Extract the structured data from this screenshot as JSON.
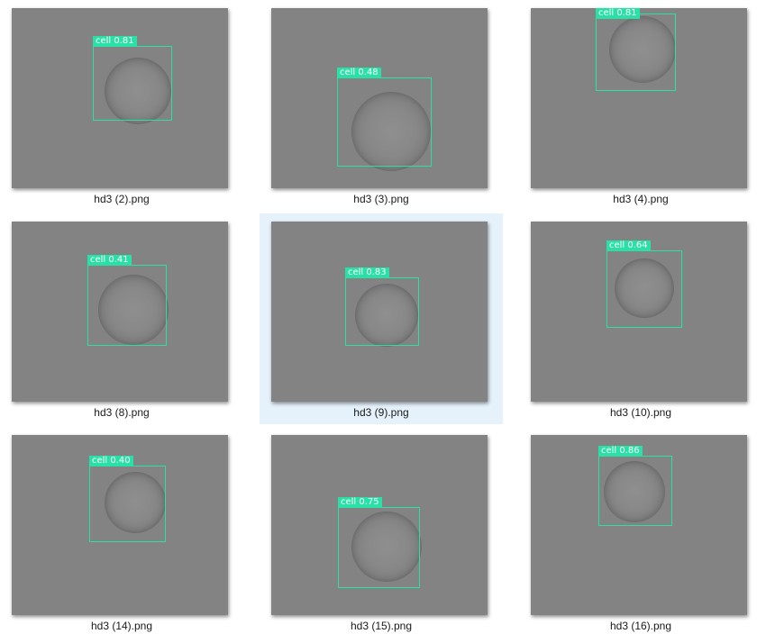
{
  "explorer": {
    "items": [
      {
        "filename": "hd3 (2).png",
        "detection": {
          "label": "cell 0.81",
          "confidence": 0.81
        },
        "selected": false
      },
      {
        "filename": "hd3 (3).png",
        "detection": {
          "label": "cell 0.48",
          "confidence": 0.48
        },
        "selected": false
      },
      {
        "filename": "hd3 (4).png",
        "detection": {
          "label": "cell 0.81",
          "confidence": 0.81
        },
        "selected": false
      },
      {
        "filename": "hd3 (8).png",
        "detection": {
          "label": "cell 0.41",
          "confidence": 0.41
        },
        "selected": false
      },
      {
        "filename": "hd3 (9).png",
        "detection": {
          "label": "cell 0.83",
          "confidence": 0.83
        },
        "selected": true
      },
      {
        "filename": "hd3 (10).png",
        "detection": {
          "label": "cell 0.64",
          "confidence": 0.64
        },
        "selected": false
      },
      {
        "filename": "hd3 (14).png",
        "detection": {
          "label": "cell 0.40",
          "confidence": 0.4
        },
        "selected": false
      },
      {
        "filename": "hd3 (15).png",
        "detection": {
          "label": "cell 0.75",
          "confidence": 0.75
        },
        "selected": false
      },
      {
        "filename": "hd3 (16).png",
        "detection": {
          "label": "cell 0.86",
          "confidence": 0.86
        },
        "selected": false
      }
    ],
    "colors": {
      "detection_box": "#29e0a7",
      "selection_highlight": "#e5f1fb",
      "thumbnail_background": "#838383"
    }
  }
}
